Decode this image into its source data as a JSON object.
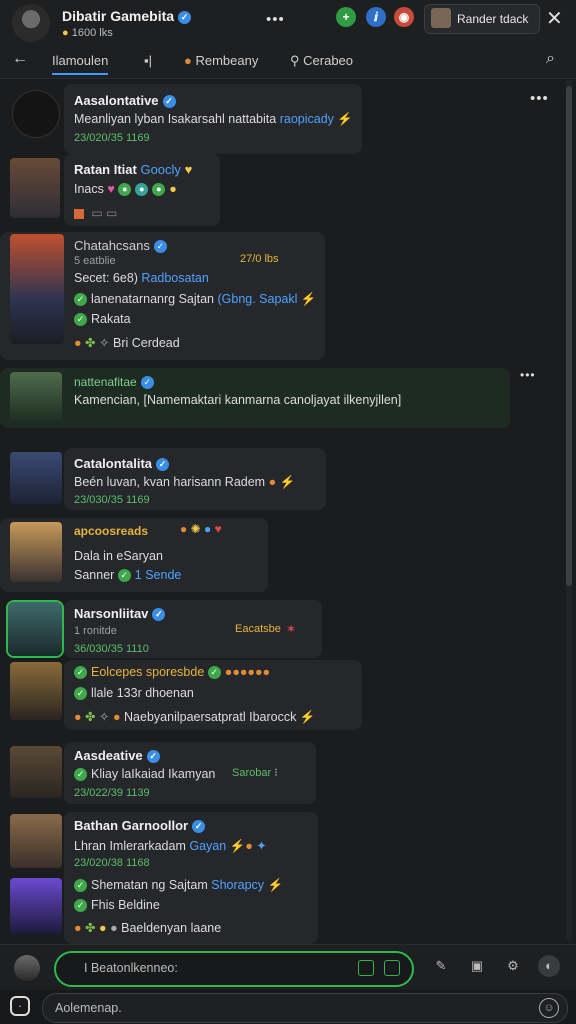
{
  "header": {
    "title": "Dibatir Gamebita",
    "subtitle": "1600 lks",
    "ext_label": "Rander tdack",
    "menu_glyph": "•••",
    "close_glyph": "✕"
  },
  "tabs": [
    {
      "label": "Ilamoulen",
      "active": true
    },
    {
      "label": "Rembeany",
      "active": false
    },
    {
      "label": "Cerabeo",
      "active": false
    }
  ],
  "messages": [
    {
      "name": "Aasalontative",
      "line1": "Meanliyan lyban Isakarsahl nattabita",
      "line1_link": "raopicady",
      "timestamp": "23/020/35 1169"
    },
    {
      "name": "Ratan Itiat",
      "name_link": "Goocly",
      "line1": "Inacs"
    },
    {
      "name": "Chatahcsans",
      "sub": "5 eatblie",
      "ts_right": "27/0 lbs",
      "line1": "Secet: 6e8)",
      "line1_link": "Radbosatan",
      "line2": "lanenatarnanrg Sajtan",
      "line2_link": "(Gbng. Sapakl",
      "line3": "Rakata",
      "line4": "Bri Cerdead"
    },
    {
      "name": "nattenafitae",
      "line1": "Kamencian, [Namemaktari kanmarna canoljayat ilkenyjllen]"
    },
    {
      "name": "Catalontalita",
      "line1": "Beén luvan, kvan harisann Radem",
      "timestamp": "23/030/35 1169"
    },
    {
      "name": "apcoosreads",
      "line1": "Dala in eSaryan",
      "line2": "Sanner",
      "line2_link": "1 Sende"
    },
    {
      "name": "Narsonliitav",
      "sub": "1 ronitde",
      "ts_right": "Eacatsbe",
      "timestamp": "36/030/35 1110",
      "line1": "Eolcepes sporesbde",
      "line2": "llale 133r dhoenan",
      "line3": "Naebyanilpaersatpratl Ibarocck"
    },
    {
      "name": "Aasdeative",
      "line1": "Kliay laIkaiad Ikamyan",
      "ts_right": "Sarobar",
      "timestamp": "23/022/39 1139"
    },
    {
      "name": "Bathan Garnoollor",
      "line1": "Lhran Imlerarkadam",
      "line1_link": "Gayan",
      "timestamp": "23/020/38 1168",
      "line2": "Shematan ng Sajtam",
      "line2_link": "Shorapcy",
      "line3": "Fhis Beldine",
      "line4": "Baeldenyan laane"
    }
  ],
  "composer": {
    "placeholder": "I Beatonlkenneo:"
  },
  "search": {
    "placeholder": "Aolemenap."
  },
  "colors": {
    "accent_green": "#2eb84e",
    "link_blue": "#4ea3ff",
    "timestamp_green": "#59c06a",
    "timestamp_orange": "#e6b53d",
    "background": "#1b1c1e"
  }
}
